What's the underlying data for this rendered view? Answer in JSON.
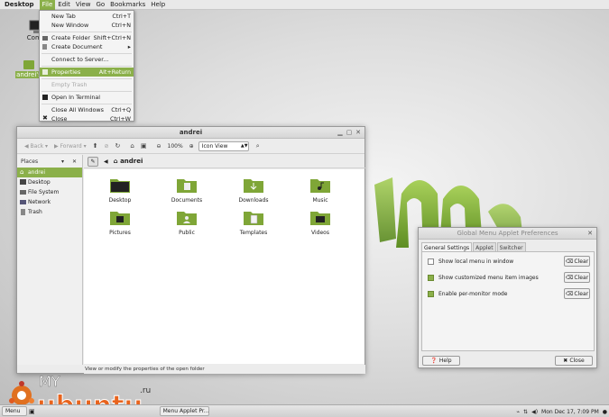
{
  "menubar": {
    "items": [
      {
        "label": "Desktop"
      },
      {
        "label": "File"
      },
      {
        "label": "Edit"
      },
      {
        "label": "View"
      },
      {
        "label": "Go"
      },
      {
        "label": "Bookmarks"
      },
      {
        "label": "Help"
      }
    ],
    "active_index": 1
  },
  "desktop_icons": {
    "computer_label": "Comp",
    "home_label": "andrei's"
  },
  "file_menu": {
    "items": [
      {
        "label": "New Tab",
        "shortcut": "Ctrl+T"
      },
      {
        "label": "New Window",
        "shortcut": "Ctrl+N"
      },
      {
        "label": "Create Folder",
        "shortcut": "Shift+Ctrl+N"
      },
      {
        "label": "Create Document",
        "shortcut": "▸"
      },
      {
        "label": "Connect to Server...",
        "shortcut": ""
      },
      {
        "label": "Properties",
        "shortcut": "Alt+Return"
      },
      {
        "label": "Empty Trash",
        "shortcut": ""
      },
      {
        "label": "Open In Terminal",
        "shortcut": ""
      },
      {
        "label": "Close All Windows",
        "shortcut": "Ctrl+Q"
      },
      {
        "label": "Close",
        "shortcut": "Ctrl+W"
      }
    ]
  },
  "file_manager": {
    "title": "andrei",
    "toolbar": {
      "back": "Back",
      "forward": "Forward",
      "zoom": "100%",
      "view_mode": "Icon View"
    },
    "sidebar": {
      "header": "Places",
      "items": [
        {
          "label": "andrei"
        },
        {
          "label": "Desktop"
        },
        {
          "label": "File System"
        },
        {
          "label": "Network"
        },
        {
          "label": "Trash"
        }
      ]
    },
    "path": "andrei",
    "folders": [
      {
        "label": "Desktop"
      },
      {
        "label": "Documents"
      },
      {
        "label": "Downloads"
      },
      {
        "label": "Music"
      },
      {
        "label": "Pictures"
      },
      {
        "label": "Public"
      },
      {
        "label": "Templates"
      },
      {
        "label": "Videos"
      }
    ],
    "status": "View or modify the properties of the open folder"
  },
  "prefs_dialog": {
    "title": "Global Menu Applet Preferences",
    "tabs": [
      {
        "label": "General Settings"
      },
      {
        "label": "Applet"
      },
      {
        "label": "Switcher"
      }
    ],
    "options": [
      {
        "label": "Show local menu in window",
        "checked": false,
        "clear": "Clear"
      },
      {
        "label": "Show customized menu item images",
        "checked": true,
        "clear": "Clear"
      },
      {
        "label": "Enable per-monitor mode",
        "checked": true,
        "clear": "Clear"
      }
    ],
    "help_button": "Help",
    "close_button": "Close"
  },
  "watermark": {
    "text": "MY UBUNTU .ru"
  },
  "taskbar": {
    "menu": "Menu",
    "task_label": "Menu Applet Pr...",
    "clock": "Mon Dec 17,  7:09 PM"
  },
  "colors": {
    "accent": "#8bb04a",
    "folder": "#7fa637"
  }
}
